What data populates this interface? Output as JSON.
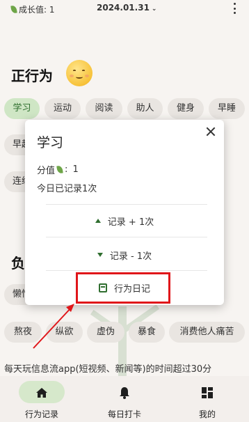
{
  "status": {
    "growth_label": "成长值: 1",
    "date": "2024.01.31"
  },
  "positive_section": {
    "title": "正行为"
  },
  "positive_chips": [
    {
      "label": "学习",
      "active": true
    },
    {
      "label": "运动"
    },
    {
      "label": "阅读"
    },
    {
      "label": "助人"
    },
    {
      "label": "健身"
    },
    {
      "label": "早睡"
    },
    {
      "label": "早起"
    },
    {
      "label": "连续"
    }
  ],
  "negative_section": {
    "title": "负"
  },
  "negative_chips": [
    {
      "label": "懒惰"
    },
    {
      "label": "熬夜"
    },
    {
      "label": "纵欲"
    },
    {
      "label": "虚伪"
    },
    {
      "label": "暴食"
    },
    {
      "label": "消费他人痛苦"
    }
  ],
  "long_item": "每天玩信息流app(短视频、新闻等)的时间超过30分",
  "dialog": {
    "title": "学习",
    "score_label": "分值",
    "score_value": "1",
    "today_count": "今日已记录1次",
    "plus_action": "记录 + 1次",
    "minus_action": "记录 - 1次",
    "diary_action": "行为日记"
  },
  "bottom_nav": [
    {
      "label": "行为记录",
      "icon": "home-icon",
      "active": true
    },
    {
      "label": "每日打卡",
      "icon": "bell-icon"
    },
    {
      "label": "我的",
      "icon": "dashboard-icon"
    }
  ],
  "colors": {
    "accent_green": "#2f6e2f",
    "chip_active": "#cfe6c5",
    "annotation_red": "#e0161a"
  }
}
